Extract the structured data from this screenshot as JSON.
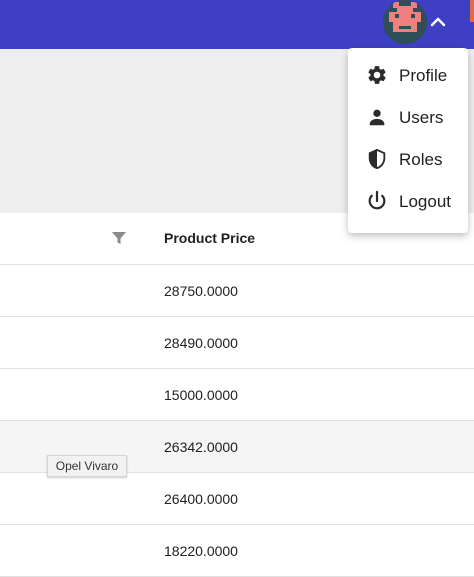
{
  "colors": {
    "topbar": "#3f3fc4",
    "avatar_bg": "#2f4f56",
    "avatar_face": "#f08080"
  },
  "table": {
    "column_header": "Product Price",
    "rows": [
      "28750.0000",
      "28490.0000",
      "15000.0000",
      "26342.0000",
      "26400.0000",
      "18220.0000"
    ]
  },
  "tooltip": {
    "text": "Opel Vivaro"
  },
  "user_menu": {
    "items": [
      {
        "label": "Profile",
        "icon": "gear-icon"
      },
      {
        "label": "Users",
        "icon": "person-icon"
      },
      {
        "label": "Roles",
        "icon": "shield-icon"
      },
      {
        "label": "Logout",
        "icon": "power-icon"
      }
    ]
  }
}
